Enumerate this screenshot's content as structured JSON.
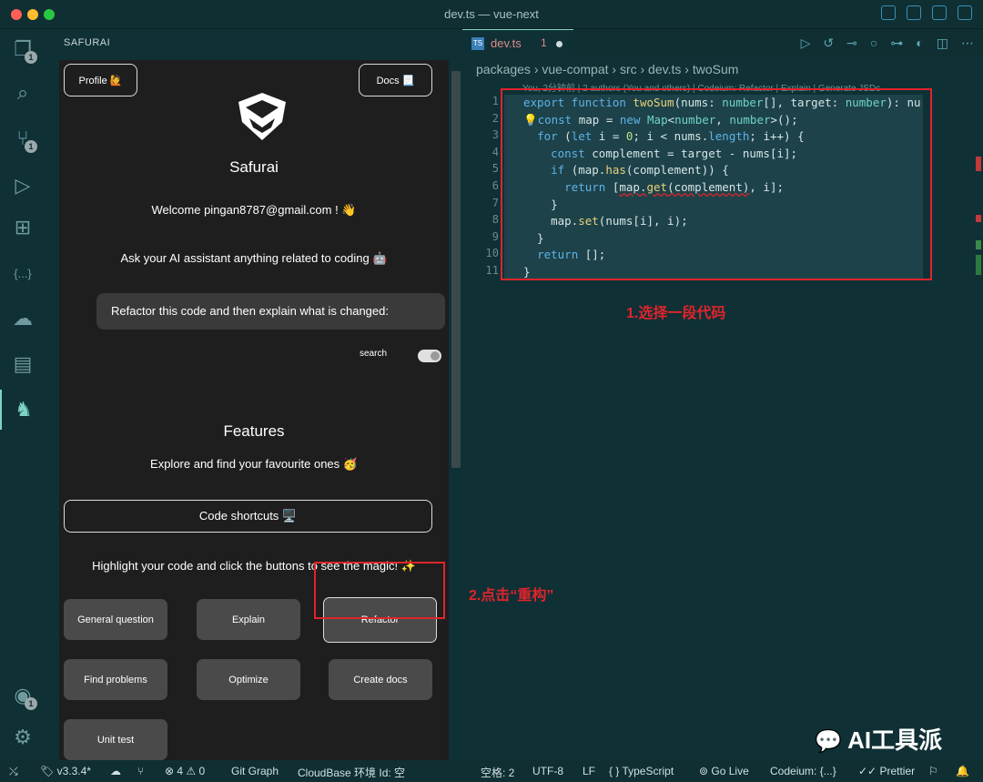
{
  "window": {
    "title": "dev.ts — vue-next",
    "traffic_colors": [
      "#ff5f57",
      "#febc2e",
      "#28c840"
    ]
  },
  "activity_bar": {
    "items": [
      {
        "icon": "files-icon",
        "glyph": "❐",
        "badge": "1"
      },
      {
        "icon": "search-icon",
        "glyph": "⌕",
        "badge": ""
      },
      {
        "icon": "source-control-icon",
        "glyph": "⑂",
        "badge": "1"
      },
      {
        "icon": "run-debug-icon",
        "glyph": "▷",
        "badge": ""
      },
      {
        "icon": "extensions-icon",
        "glyph": "⊞",
        "badge": ""
      },
      {
        "icon": "json-icon",
        "glyph": "{...}",
        "badge": ""
      },
      {
        "icon": "cloud-icon",
        "glyph": "☁",
        "badge": ""
      },
      {
        "icon": "docker-icon",
        "glyph": "▤",
        "badge": ""
      },
      {
        "icon": "safurai-icon",
        "glyph": "♞",
        "badge": ""
      }
    ],
    "bottom": [
      {
        "icon": "account-icon",
        "glyph": "◉",
        "badge": "1"
      },
      {
        "icon": "settings-gear-icon",
        "glyph": "⚙",
        "badge": ""
      }
    ]
  },
  "sidebar": {
    "title": "SAFURAI",
    "profile_label": "Profile 🙋",
    "docs_label": "Docs 📃",
    "brand": "Safurai",
    "welcome": "Welcome pingan8787@gmail.com ! 👋",
    "ask": "Ask your AI assistant anything related to coding 🤖",
    "prompt_text": "Refactor this code and then explain what is changed:",
    "search_label": "search",
    "features_title": "Features",
    "features_sub": "Explore and find your favourite ones 🥳",
    "shortcuts_label": "Code shortcuts 🖥️",
    "highlight_text": "Highlight your code and click the buttons to see the magic! ✨",
    "buttons": [
      "General question",
      "Explain",
      "Refactor",
      "Find problems",
      "Optimize",
      "Create docs",
      "Unit test"
    ]
  },
  "editor": {
    "tab_label": "dev.ts",
    "tab_badge": "1",
    "breadcrumbs": "packages › vue-compat › src › dev.ts › twoSum",
    "codelens": "You, 2分钟前 | 2 authors (You and others) | Codeium: Refactor | Explain | Generate JSDc",
    "line_numbers": [
      "1",
      "2",
      "3",
      "4",
      "5",
      "6",
      "7",
      "8",
      "9",
      "10",
      "11"
    ],
    "annotation_1": "1.选择一段代码",
    "annotation_2": "2.点击“重构”"
  },
  "statusbar": {
    "version": "v3.3.4*",
    "errors": "⊗ 4 ⚠ 0",
    "git_graph": "Git Graph",
    "cloudbase": "CloudBase 环境 Id: 空",
    "spaces": "空格: 2",
    "encoding": "UTF-8",
    "eol": "LF",
    "language": "{ } TypeScript",
    "golive": "Go Live",
    "codeium": "Codeium: {...}",
    "prettier": "✓✓ Prettier"
  },
  "watermark": "AI工具派",
  "colors": {
    "accent": "#7ed3c8",
    "annotation": "#e0242b"
  }
}
